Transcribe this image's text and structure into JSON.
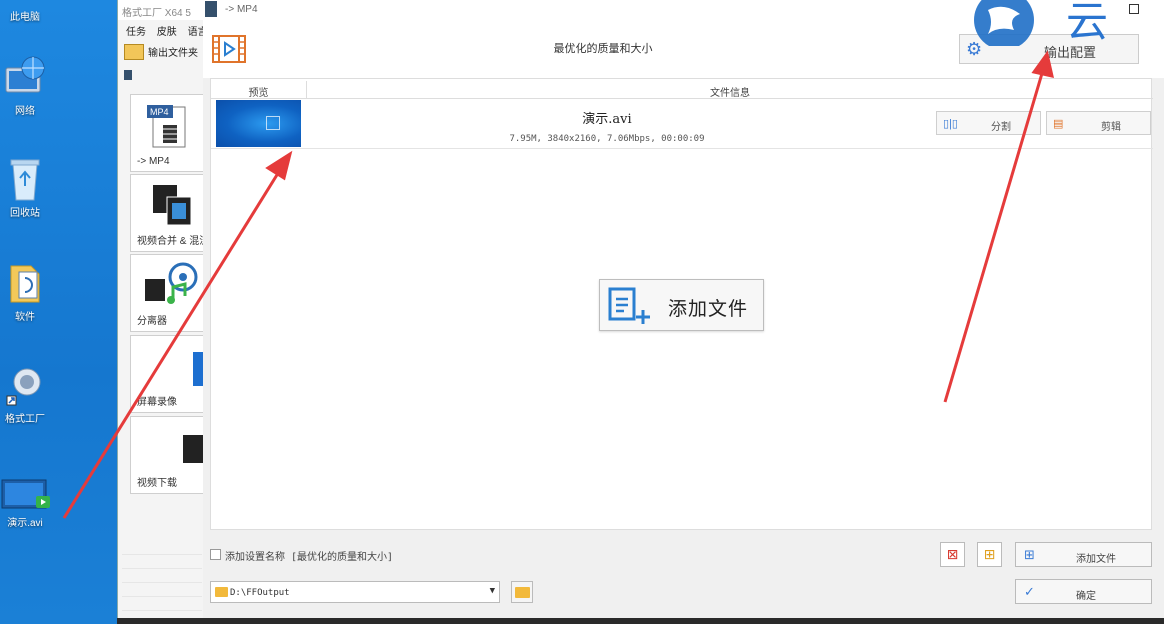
{
  "desktop": {
    "icons": [
      {
        "label": "此电脑"
      },
      {
        "label": "网络"
      },
      {
        "label": "回收站"
      },
      {
        "label": "软件"
      },
      {
        "label": "格式工厂"
      },
      {
        "label": "演示.avi"
      }
    ]
  },
  "main_window": {
    "title": "格式工厂 X64 5",
    "menu": [
      "任务",
      "皮肤",
      "语言"
    ],
    "toolbar_label": "输出文件夹",
    "categories": [
      {
        "label": "-> MP4",
        "icon": "mp4-icon"
      },
      {
        "label": "视频合并 & 混流",
        "icon": "film-merge-icon"
      },
      {
        "label": "分离器",
        "icon": "separator-icon"
      },
      {
        "label": "屏幕录像",
        "icon": "screen-record-icon"
      },
      {
        "label": "视频下载",
        "icon": "video-download-icon"
      }
    ]
  },
  "dialog": {
    "title": "-> MP4",
    "header_title": "最优化的质量和大小",
    "config_button": "输出配置",
    "table": {
      "col_preview": "预览",
      "col_info": "文件信息"
    },
    "file": {
      "name": "演示.avi",
      "meta": "7.95M, 3840x2160, 7.06Mbps, 00:00:09"
    },
    "split_button": "分割",
    "trim_button": "剪辑",
    "add_file_big": "添加文件",
    "checkbox_label": "添加设置名称 [最优化的质量和大小]",
    "output_path": "D:\\FFOutput",
    "add_file_button": "添加文件",
    "ok_button": "确定"
  },
  "watermark": {
    "text": "云"
  },
  "colors": {
    "desktop": "#1a7fd4",
    "annotation_arrow": "#e53b3b",
    "accent": "#3a7bd5"
  }
}
